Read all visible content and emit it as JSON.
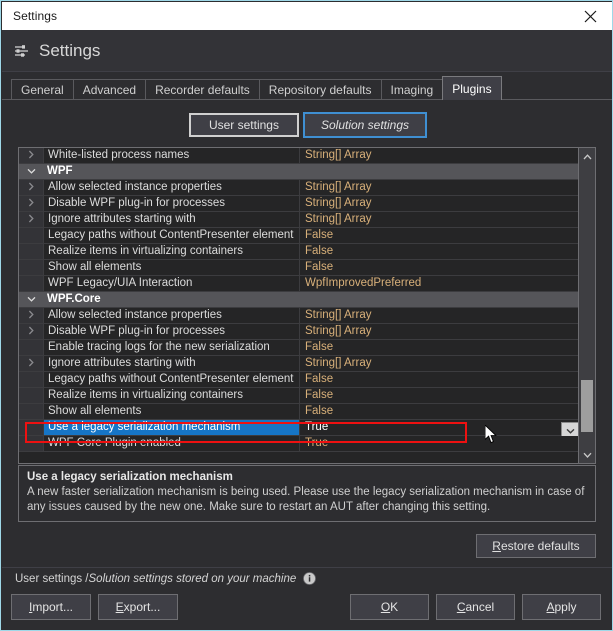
{
  "window": {
    "title": "Settings",
    "close_icon": "close-icon"
  },
  "header": {
    "title": "Settings",
    "icon": "sliders-icon"
  },
  "tabs": [
    {
      "label": "General",
      "active": false
    },
    {
      "label": "Advanced",
      "active": false
    },
    {
      "label": "Recorder defaults",
      "active": false
    },
    {
      "label": "Repository defaults",
      "active": false
    },
    {
      "label": "Imaging",
      "active": false
    },
    {
      "label": "Plugins",
      "active": true
    }
  ],
  "scope": {
    "user_label": "User settings",
    "solution_label": "Solution settings",
    "selected": "Solution settings"
  },
  "grid": {
    "rows": [
      {
        "kind": "prop",
        "expander": true,
        "name": "White-listed process names",
        "value": "String[] Array"
      },
      {
        "kind": "group",
        "expander": false,
        "name": "WPF",
        "value": ""
      },
      {
        "kind": "prop",
        "expander": true,
        "name": "Allow selected instance properties",
        "value": "String[] Array"
      },
      {
        "kind": "prop",
        "expander": true,
        "name": "Disable WPF plug-in for processes",
        "value": "String[] Array"
      },
      {
        "kind": "prop",
        "expander": true,
        "name": "Ignore attributes starting with",
        "value": "String[] Array"
      },
      {
        "kind": "prop",
        "expander": false,
        "name": "Legacy paths without ContentPresenter element",
        "value": "False"
      },
      {
        "kind": "prop",
        "expander": false,
        "name": "Realize items in virtualizing containers",
        "value": "False"
      },
      {
        "kind": "prop",
        "expander": false,
        "name": "Show all elements",
        "value": "False"
      },
      {
        "kind": "prop",
        "expander": false,
        "name": "WPF Legacy/UIA Interaction",
        "value": "WpfImprovedPreferred"
      },
      {
        "kind": "group",
        "expander": false,
        "name": "WPF.Core",
        "value": ""
      },
      {
        "kind": "prop",
        "expander": true,
        "name": "Allow selected instance properties",
        "value": "String[] Array"
      },
      {
        "kind": "prop",
        "expander": true,
        "name": "Disable WPF plug-in for processes",
        "value": "String[] Array"
      },
      {
        "kind": "prop",
        "expander": false,
        "name": "Enable tracing logs for the new serialization",
        "value": "False"
      },
      {
        "kind": "prop",
        "expander": true,
        "name": "Ignore attributes starting with",
        "value": "String[] Array"
      },
      {
        "kind": "prop",
        "expander": false,
        "name": "Legacy paths without ContentPresenter element",
        "value": "False"
      },
      {
        "kind": "prop",
        "expander": false,
        "name": "Realize items in virtualizing containers",
        "value": "False"
      },
      {
        "kind": "prop",
        "expander": false,
        "name": "Show all elements",
        "value": "False"
      },
      {
        "kind": "selected",
        "expander": false,
        "name": "Use a legacy serialization mechanism",
        "value": "True"
      },
      {
        "kind": "prop",
        "expander": false,
        "name": "WPF Core Plugin enabled",
        "value": "True"
      }
    ],
    "scroll_up_icon": "chevron-up-icon",
    "scroll_down_icon": "chevron-down-icon",
    "dropdown_icon": "chevron-down-icon"
  },
  "description": {
    "title": "Use a legacy serialization mechanism",
    "body": "A new faster serialization mechanism is being used. Please use the legacy serialization mechanism in case of any issues caused by the new one. Make sure to restart an AUT after changing this setting."
  },
  "restore": {
    "label_accel": "R",
    "label_rest": "estore defaults"
  },
  "footer": {
    "status_plain": "User settings / ",
    "status_italic": "Solution settings stored  on your machine",
    "info_icon": "info-icon",
    "buttons": {
      "import_accel": "I",
      "import_rest": "mport...",
      "export_accel": "E",
      "export_rest": "xport...",
      "ok_accel": "O",
      "ok_rest": "K",
      "cancel_accel": "C",
      "cancel_rest": "ancel",
      "apply_accel": "A",
      "apply_rest": "pply"
    }
  },
  "colors": {
    "accent_selection": "#1675c6",
    "annotation": "#ee1111",
    "value_text": "#d8b07a",
    "window_border": "#9fd8e8",
    "focus_border": "#3f8fd2"
  }
}
